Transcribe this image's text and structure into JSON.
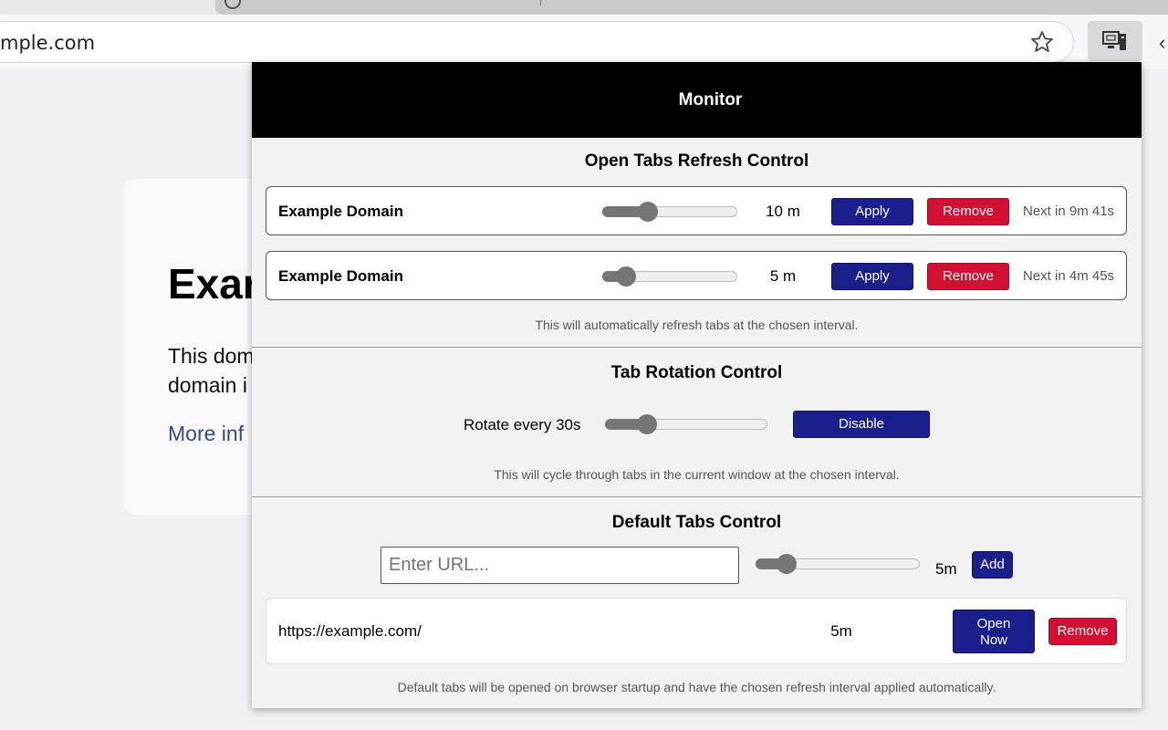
{
  "browser": {
    "url": "mple.com"
  },
  "page": {
    "title": "Exar",
    "body_line1": "This dom",
    "body_line2": "domain i",
    "link": "More inf"
  },
  "popup": {
    "title": "Monitor",
    "refresh": {
      "title": "Open Tabs Refresh Control",
      "rows": [
        {
          "name": "Example Domain",
          "interval": "10 m",
          "slider_fraction": 0.33,
          "apply": "Apply",
          "remove": "Remove",
          "next": "Next in 9m 41s"
        },
        {
          "name": "Example Domain",
          "interval": "5 m",
          "slider_fraction": 0.18,
          "apply": "Apply",
          "remove": "Remove",
          "next": "Next in 4m 45s"
        }
      ],
      "note": "This will automatically refresh tabs at the chosen interval."
    },
    "rotation": {
      "title": "Tab Rotation Control",
      "label": "Rotate every 30s",
      "slider_fraction": 0.25,
      "button": "Disable",
      "note": "This will cycle through tabs in the current window at the chosen interval."
    },
    "defaults": {
      "title": "Default Tabs Control",
      "placeholder": "Enter URL...",
      "slider_fraction": 0.18,
      "interval": "5m",
      "add": "Add",
      "rows": [
        {
          "url": "https://example.com/",
          "interval": "5m",
          "open_line1": "Open",
          "open_line2": "Now",
          "remove": "Remove"
        }
      ],
      "note": "Default tabs will be opened on browser startup and have the chosen refresh interval applied automatically."
    }
  },
  "colors": {
    "primary": "#1a1f8c",
    "danger": "#d21033",
    "header": "#000000"
  }
}
